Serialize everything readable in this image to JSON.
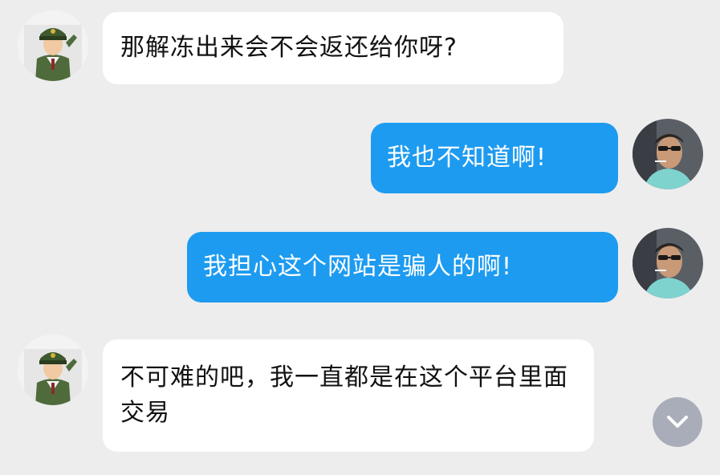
{
  "chat": {
    "messages": [
      {
        "sender": "contact",
        "text": "那解冻出来会不会返还给你呀?"
      },
      {
        "sender": "me",
        "text": "我也不知道啊!"
      },
      {
        "sender": "me",
        "text": "我担心这个网站是骗人的啊!"
      },
      {
        "sender": "contact",
        "text": "不可难的吧，我一直都是在这个平台里面交易"
      }
    ],
    "colors": {
      "background": "#ededed",
      "incoming": "#ffffff",
      "outgoing": "#1d9bf0"
    },
    "contact_avatar_icon": "soldier-cartoon-avatar",
    "my_avatar_icon": "man-sunglasses-photo-avatar",
    "scroll_down_icon": "chevron-down-icon"
  }
}
